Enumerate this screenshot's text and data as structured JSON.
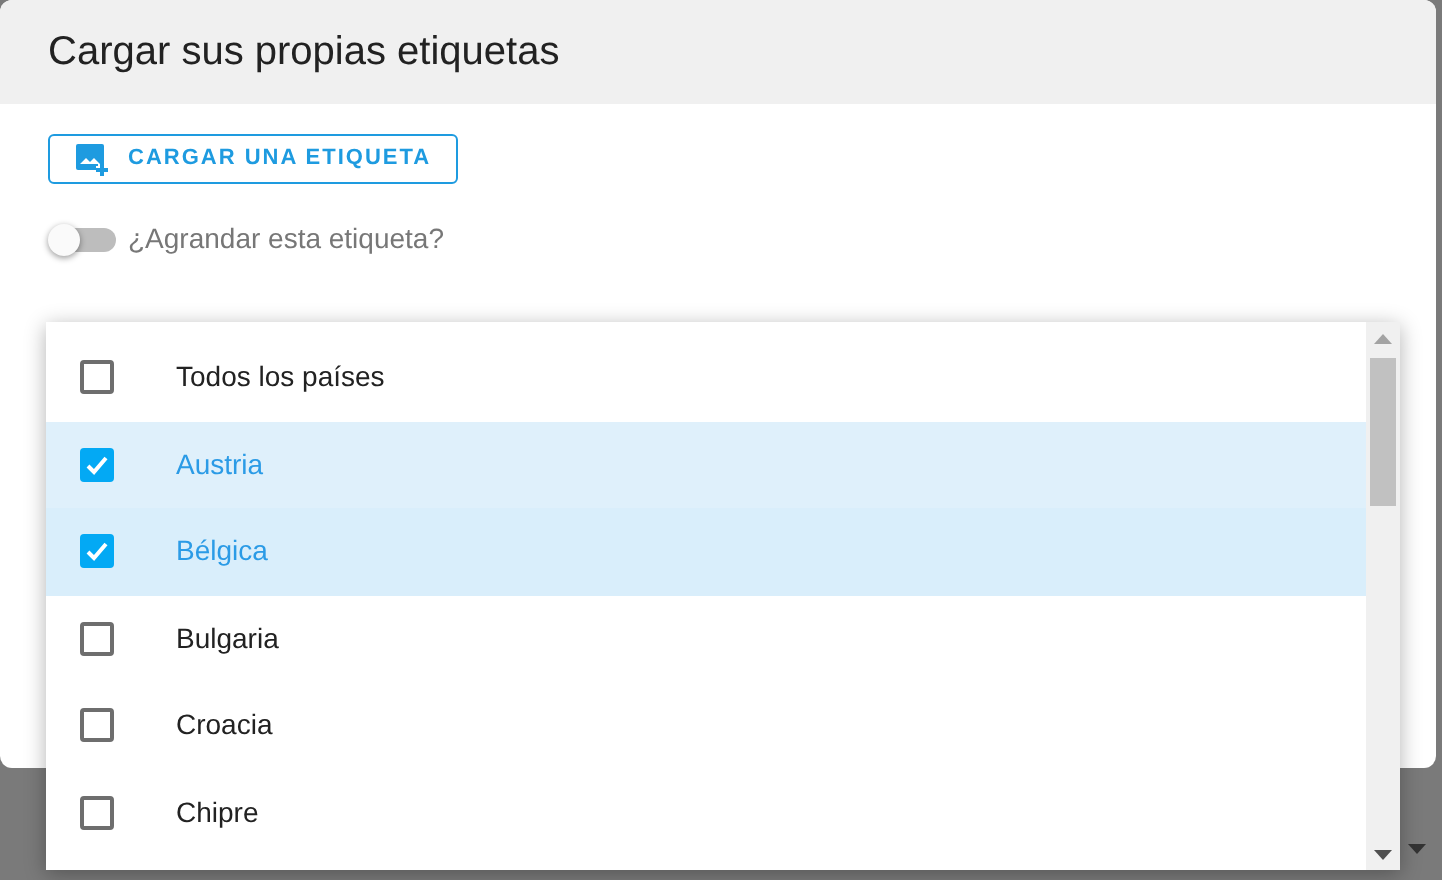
{
  "dialog": {
    "title": "Cargar sus propias etiquetas",
    "upload_button": "CARGAR UNA ETIQUETA",
    "toggle": {
      "label": "¿Agrandar esta etiqueta?",
      "on": false
    }
  },
  "country_list": [
    {
      "label": "Todos los países",
      "checked": false
    },
    {
      "label": "Austria",
      "checked": true
    },
    {
      "label": "Bélgica",
      "checked": true
    },
    {
      "label": "Bulgaria",
      "checked": false
    },
    {
      "label": "Croacia",
      "checked": false
    },
    {
      "label": "Chipre",
      "checked": false
    }
  ]
}
